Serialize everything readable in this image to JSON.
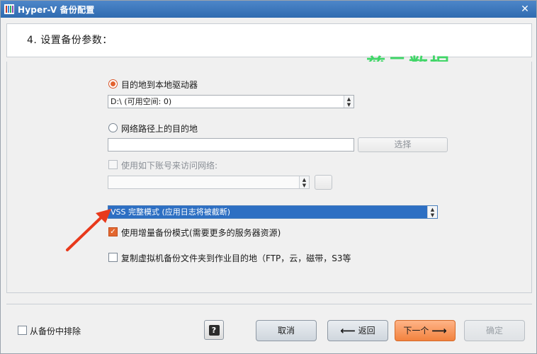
{
  "window": {
    "title": "Hyper-V 备份配置",
    "close_icon": "close-icon",
    "close_glyph": "✕"
  },
  "header": {
    "step_title": "4. 设置备份参数："
  },
  "watermark": {
    "text": "慈云数据",
    "color": "#2fd45a"
  },
  "destination": {
    "local_radio_label": "目的地到本地驱动器",
    "local_selected": true,
    "local_drive_value": "D:\\  (可用空间: 0)",
    "network_radio_label": "网络路径上的目的地",
    "network_selected": false,
    "network_path_value": "",
    "select_button_label": "选择",
    "use_account_label": "使用如下账号来访问网络:",
    "use_account_checked": false,
    "account_value": ""
  },
  "options": {
    "vss_mode_value": "VSS 完整模式 (应用日志将被截断)",
    "incremental_label": "使用增量备份模式(需要更多的服务器资源)",
    "incremental_checked": true,
    "copy_label": "复制虚拟机备份文件夹到作业目的地（FTP，云，磁带，S3等",
    "copy_checked": false
  },
  "footer": {
    "exclude_label": "从备份中排除",
    "exclude_checked": false,
    "help_label": "?",
    "cancel_label": "取消",
    "back_label": "返回",
    "next_label": "下一个",
    "ok_label": "确定"
  },
  "colors": {
    "accent": "#f2823e",
    "titlebar": "#2f6bb0",
    "highlight": "#2d6fc3",
    "pointer": "#e8391b"
  },
  "icons": {
    "app": "hyperv-app-icon",
    "back": "arrow-left-icon",
    "next": "arrow-right-icon",
    "check": "checkmark-icon",
    "spin": "spinner-arrows-icon"
  }
}
